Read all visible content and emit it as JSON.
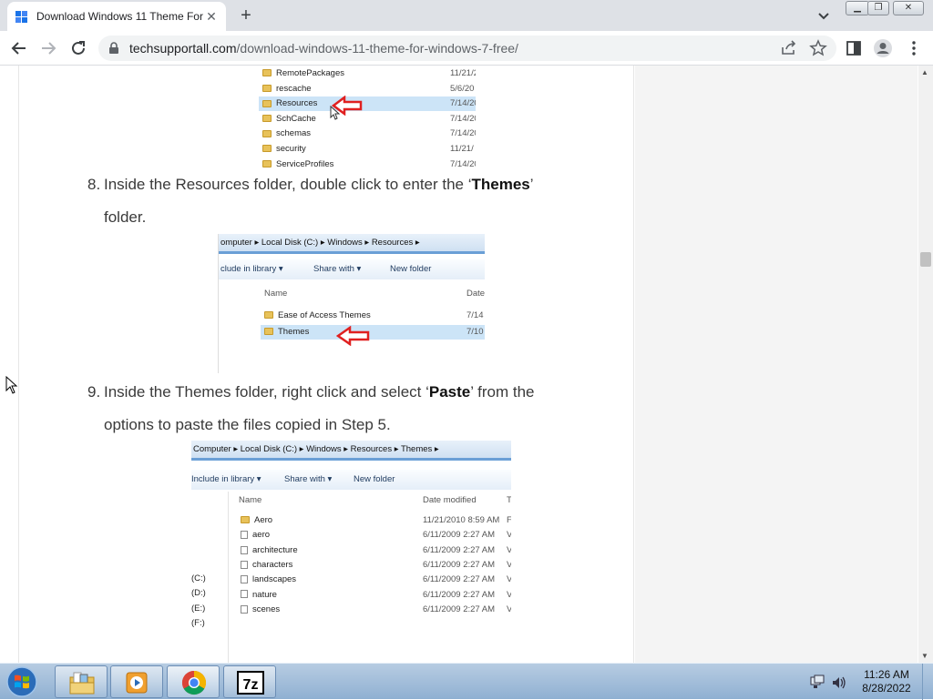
{
  "browser": {
    "tab": {
      "title": "Download Windows 11 Theme For Windows 7 Free"
    },
    "url": {
      "domain": "techsupportall.com",
      "path": "/download-windows-11-theme-for-windows-7-free/"
    }
  },
  "article": {
    "image1": {
      "folders": [
        {
          "name": "RemotePackages",
          "date": "11/21/2"
        },
        {
          "name": "rescache",
          "date": "5/6/20"
        },
        {
          "name": "Resources",
          "date": "7/14/20"
        },
        {
          "name": "SchCache",
          "date": "7/14/20"
        },
        {
          "name": "schemas",
          "date": "7/14/20"
        },
        {
          "name": "security",
          "date": "11/21/"
        },
        {
          "name": "ServiceProfiles",
          "date": "7/14/20"
        }
      ]
    },
    "step8": {
      "num": "8.",
      "line1_pre": "Inside the Resources folder, double click to enter the ‘",
      "line1_bold": "Themes",
      "line1_post": "’",
      "line2": "folder."
    },
    "image2": {
      "address": "omputer  ▸  Local Disk (C:)  ▸  Windows  ▸  Resources  ▸",
      "cmd": {
        "include": "clude in library ▾",
        "share": "Share with ▾",
        "newfolder": "New folder"
      },
      "header": {
        "name": "Name",
        "date": "Date"
      },
      "folders": [
        {
          "name": "Ease of Access Themes",
          "date": "7/14"
        },
        {
          "name": "Themes",
          "date": "7/10"
        }
      ]
    },
    "step9": {
      "num": "9.",
      "line1_pre": "Inside the Themes folder, right click and select ‘",
      "line1_bold": "Paste",
      "line1_post": "’ from the",
      "line2": "options to paste the files copied in Step 5."
    },
    "image3": {
      "address": "Computer  ▸  Local Disk (C:)  ▸  Windows  ▸  Resources  ▸  Themes  ▸",
      "cmd": {
        "include": "Include in library ▾",
        "share": "Share with ▾",
        "newfolder": "New folder"
      },
      "header": {
        "name": "Name",
        "date": "Date modified",
        "type": "T"
      },
      "items": [
        {
          "name": "Aero",
          "date": "11/21/2010 8:59 AM",
          "kind": "folder",
          "type": "F"
        },
        {
          "name": "aero",
          "date": "6/11/2009 2:27 AM",
          "kind": "file",
          "type": "V"
        },
        {
          "name": "architecture",
          "date": "6/11/2009 2:27 AM",
          "kind": "file",
          "type": "V"
        },
        {
          "name": "characters",
          "date": "6/11/2009 2:27 AM",
          "kind": "file",
          "type": "V"
        },
        {
          "name": "landscapes",
          "date": "6/11/2009 2:27 AM",
          "kind": "file",
          "type": "V"
        },
        {
          "name": "nature",
          "date": "6/11/2009 2:27 AM",
          "kind": "file",
          "type": "V"
        },
        {
          "name": "scenes",
          "date": "6/11/2009 2:27 AM",
          "kind": "file",
          "type": "V"
        }
      ],
      "drives": [
        "(C:)",
        "(D:)",
        "(E:)",
        "(F:)"
      ]
    }
  },
  "taskbar": {
    "clock": {
      "time": "11:26 AM",
      "date": "8/28/2022"
    },
    "apps": [
      "windows-explorer",
      "media-player",
      "chrome",
      "7-zip"
    ],
    "zip_label": "7z"
  }
}
